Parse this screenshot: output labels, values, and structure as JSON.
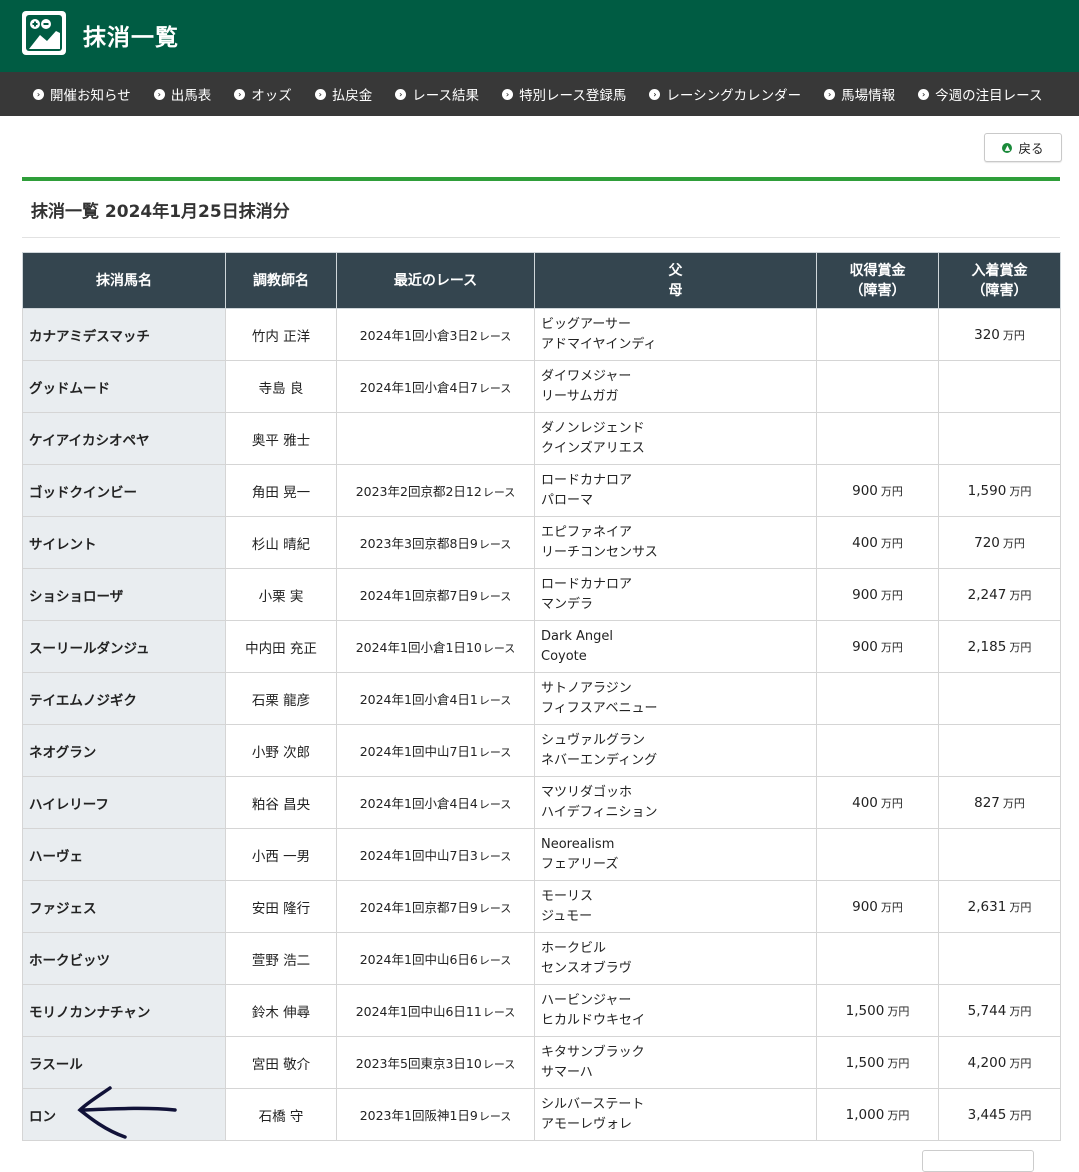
{
  "header": {
    "title": "抹消一覧"
  },
  "nav": [
    "開催お知らせ",
    "出馬表",
    "オッズ",
    "払戻金",
    "レース結果",
    "特別レース登録馬",
    "レーシングカレンダー",
    "馬場情報",
    "今週の注目レース"
  ],
  "back_label": "戻る",
  "section_title": "抹消一覧 2024年1月25日抹消分",
  "columns": {
    "name": "抹消馬名",
    "trainer": "調教師名",
    "race": "最近のレース",
    "sire": "父",
    "dam": "母",
    "earned": "収得賞金",
    "earned_sub": "（障害）",
    "prize": "入着賞金",
    "prize_sub": "（障害）"
  },
  "unit": "万円",
  "rows": [
    {
      "name": "カナアミデスマッチ",
      "trainer": "竹内 正洋",
      "race": "2024年1回小倉3日2",
      "sire": "ビッグアーサー",
      "dam": "アドマイヤインディ",
      "earned": "",
      "prize": "320"
    },
    {
      "name": "グッドムード",
      "trainer": "寺島 良",
      "race": "2024年1回小倉4日7",
      "sire": "ダイワメジャー",
      "dam": "リーサムガガ",
      "earned": "",
      "prize": ""
    },
    {
      "name": "ケイアイカシオペヤ",
      "trainer": "奥平 雅士",
      "race": "",
      "sire": "ダノンレジェンド",
      "dam": "クインズアリエス",
      "earned": "",
      "prize": ""
    },
    {
      "name": "ゴッドクインビー",
      "trainer": "角田 晃一",
      "race": "2023年2回京都2日12",
      "sire": "ロードカナロア",
      "dam": "パローマ",
      "earned": "900",
      "prize": "1,590"
    },
    {
      "name": "サイレント",
      "trainer": "杉山 晴紀",
      "race": "2023年3回京都8日9",
      "sire": "エピファネイア",
      "dam": "リーチコンセンサス",
      "earned": "400",
      "prize": "720"
    },
    {
      "name": "ショショローザ",
      "trainer": "小栗 実",
      "race": "2024年1回京都7日9",
      "sire": "ロードカナロア",
      "dam": "マンデラ",
      "earned": "900",
      "prize": "2,247"
    },
    {
      "name": "スーリールダンジュ",
      "trainer": "中内田 充正",
      "race": "2024年1回小倉1日10",
      "sire": "Dark Angel",
      "dam": "Coyote",
      "earned": "900",
      "prize": "2,185"
    },
    {
      "name": "テイエムノジギク",
      "trainer": "石栗 龍彦",
      "race": "2024年1回小倉4日1",
      "sire": "サトノアラジン",
      "dam": "フィフスアベニュー",
      "earned": "",
      "prize": ""
    },
    {
      "name": "ネオグラン",
      "trainer": "小野 次郎",
      "race": "2024年1回中山7日1",
      "sire": "シュヴァルグラン",
      "dam": "ネバーエンディング",
      "earned": "",
      "prize": ""
    },
    {
      "name": "ハイレリーフ",
      "trainer": "粕谷 昌央",
      "race": "2024年1回小倉4日4",
      "sire": "マツリダゴッホ",
      "dam": "ハイデフィニション",
      "earned": "400",
      "prize": "827"
    },
    {
      "name": "ハーヴェ",
      "trainer": "小西 一男",
      "race": "2024年1回中山7日3",
      "sire": "Neorealism",
      "dam": "フェアリーズ",
      "earned": "",
      "prize": ""
    },
    {
      "name": "ファジェス",
      "trainer": "安田 隆行",
      "race": "2024年1回京都7日9",
      "sire": "モーリス",
      "dam": "ジュモー",
      "earned": "900",
      "prize": "2,631"
    },
    {
      "name": "ホークビッツ",
      "trainer": "萱野 浩二",
      "race": "2024年1回中山6日6",
      "sire": "ホークビル",
      "dam": "センスオブラヴ",
      "earned": "",
      "prize": ""
    },
    {
      "name": "モリノカンナチャン",
      "trainer": "鈴木 伸尋",
      "race": "2024年1回中山6日11",
      "sire": "ハービンジャー",
      "dam": "ヒカルドウキセイ",
      "earned": "1,500",
      "prize": "5,744"
    },
    {
      "name": "ラスール",
      "trainer": "宮田 敬介",
      "race": "2023年5回東京3日10",
      "sire": "キタサンブラック",
      "dam": "サマーハ",
      "earned": "1,500",
      "prize": "4,200"
    },
    {
      "name": "ロン",
      "trainer": "石橋 守",
      "race": "2023年1回阪神1日9",
      "sire": "シルバーステート",
      "dam": "アモーレヴォレ",
      "earned": "1,000",
      "prize": "3,445"
    }
  ],
  "race_suffix": "レース"
}
